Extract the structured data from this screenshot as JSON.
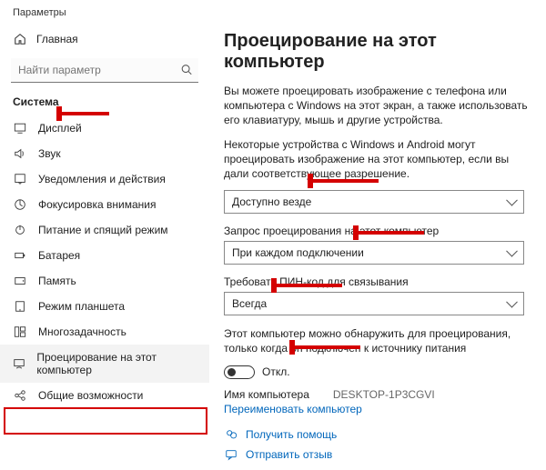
{
  "titlebar": "Параметры",
  "home_label": "Главная",
  "search_placeholder": "Найти параметр",
  "section": "Система",
  "nav": {
    "display": "Дисплей",
    "sound": "Звук",
    "notifications": "Уведомления и действия",
    "focus": "Фокусировка внимания",
    "power": "Питание и спящий режим",
    "battery": "Батарея",
    "storage": "Память",
    "tablet": "Режим планшета",
    "multitask": "Многозадачность",
    "projecting": "Проецирование на этот компьютер",
    "shared": "Общие возможности"
  },
  "main": {
    "title": "Проецирование на этот компьютер",
    "desc1": "Вы можете проецировать изображение с телефона или компьютера с Windows на этот экран, а также использовать его клавиатуру, мышь и другие устройства.",
    "desc2": "Некоторые устройства с Windows и Android могут проецировать изображение на этот компьютер, если вы дали соответствующее разрешение.",
    "select1_value": "Доступно везде",
    "label2": "Запрос проецирования на этот компьютер",
    "select2_value": "При каждом подключении",
    "label3": "Требовать ПИН-код для связывания",
    "select3_value": "Всегда",
    "desc4": "Этот компьютер можно обнаружить для проецирования, только когда он подключен к источнику питания",
    "toggle_label": "Откл.",
    "pc_name_label": "Имя компьютера",
    "pc_name_value": "DESKTOP-1P3CGVI",
    "rename_link": "Переименовать компьютер",
    "help_link": "Получить помощь",
    "feedback_link": "Отправить отзыв"
  }
}
